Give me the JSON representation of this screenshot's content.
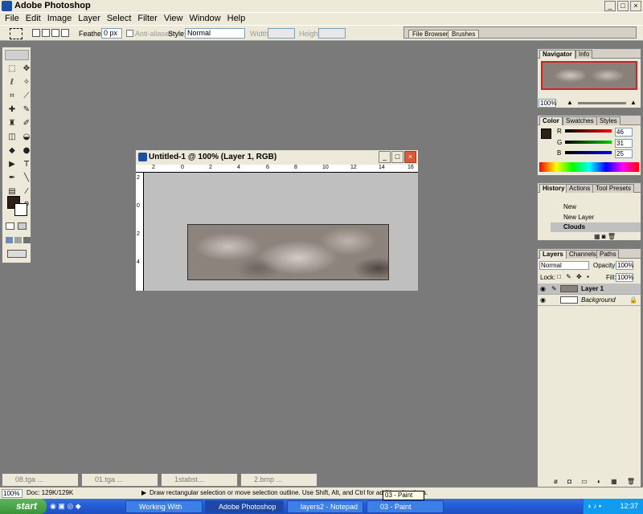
{
  "app": {
    "title": "Adobe Photoshop"
  },
  "menu": [
    "File",
    "Edit",
    "Image",
    "Layer",
    "Select",
    "Filter",
    "View",
    "Window",
    "Help"
  ],
  "options": {
    "feather_label": "Feather:",
    "feather_value": "0 px",
    "antialiased_label": "Anti-aliased",
    "style_label": "Style:",
    "style_value": "Normal",
    "width_label": "Width:",
    "height_label": "Height:"
  },
  "palette_well": {
    "tabs": [
      "File Browser",
      "Brushes"
    ]
  },
  "document": {
    "title": "Untitled-1 @ 100% (Layer 1, RGB)",
    "ruler_top": [
      "2",
      "0",
      "2",
      "4",
      "6",
      "8",
      "10",
      "12",
      "14",
      "16"
    ],
    "ruler_left": [
      "2",
      "0",
      "2",
      "4"
    ]
  },
  "navigator": {
    "tabs": [
      "Navigator",
      "Info"
    ],
    "zoom": "100%"
  },
  "color": {
    "tabs": [
      "Color",
      "Swatches",
      "Styles"
    ],
    "channels": [
      {
        "label": "R",
        "value": "46",
        "color": "#cc0000"
      },
      {
        "label": "G",
        "value": "31",
        "color": "#00aa00"
      },
      {
        "label": "B",
        "value": "25",
        "color": "#0000cc"
      }
    ]
  },
  "history": {
    "tabs": [
      "History",
      "Actions",
      "Tool Presets"
    ],
    "items": [
      "New",
      "New Layer",
      "Clouds"
    ]
  },
  "layers": {
    "tabs": [
      "Layers",
      "Channels",
      "Paths"
    ],
    "blend_mode": "Normal",
    "opacity_label": "Opacity:",
    "opacity_value": "100%",
    "lock_label": "Lock:",
    "fill_label": "Fill:",
    "fill_value": "100%",
    "items": [
      "Layer 1",
      "Background"
    ]
  },
  "minimized_docs": [
    "08.tga ...",
    "01.tga ...",
    "1stabst...",
    "2.bmp ..."
  ],
  "status": {
    "zoom": "100%",
    "doc": "Doc: 129K/129K",
    "hint": "Draw rectangular selection or move selection outline.  Use Shift, Alt, and Ctrl for additional options."
  },
  "taskbar": {
    "start": "start",
    "items": [
      "Working With Layers ...",
      "Adobe Photoshop",
      "layers2 - Notepad",
      "03 - Paint"
    ],
    "clock": "12:37",
    "tooltip": "03 - Paint"
  },
  "colors": {
    "foreground": "#2e1f19",
    "background": "#ffffff",
    "workspace": "#7a7a7a"
  }
}
